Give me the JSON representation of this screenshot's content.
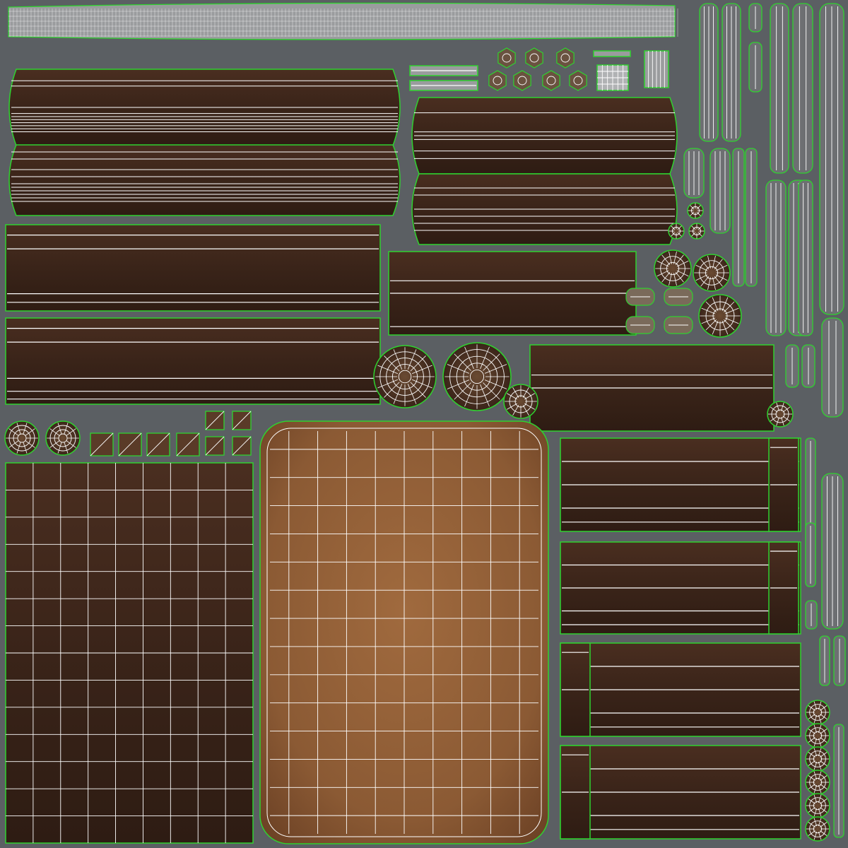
{
  "texture_atlas": {
    "colors": {
      "background": "#5b5f63",
      "seam_outline": "#2fd22f",
      "wireframe": "#ffffff",
      "dark_wood": "#3a2419",
      "mid_wood": "#5a3b28",
      "light_wood": "#8a6a4a",
      "leather": "#8b5a34",
      "leather_light": "#a8774a"
    },
    "island_kinds": [
      "plank",
      "profile-molding",
      "rounded-leather-panel",
      "grid-panel",
      "round-cap",
      "bolt-head",
      "column-strip",
      "small-tile"
    ]
  }
}
